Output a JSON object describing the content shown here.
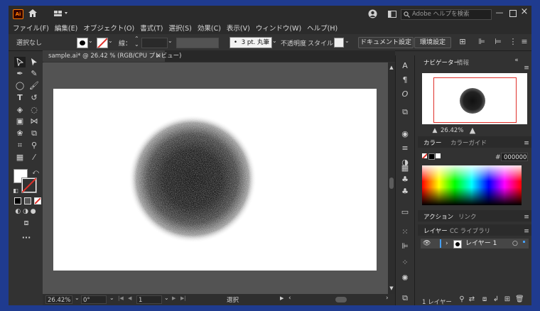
{
  "titlebar": {
    "app_badge": "Ai",
    "search_placeholder": "Adobe ヘルプを検索"
  },
  "menu": [
    "ファイル(F)",
    "編集(E)",
    "オブジェクト(O)",
    "書式(T)",
    "選択(S)",
    "効果(C)",
    "表示(V)",
    "ウィンドウ(W)",
    "ヘルプ(H)"
  ],
  "control": {
    "selection": "選択なし",
    "stroke_label": "線：",
    "brush_value": "3 pt. 丸筆",
    "opacity_label": "不透明度",
    "style_label": "スタイル：",
    "doc_settings": "ドキュメント設定",
    "prefs": "環境設定"
  },
  "document": {
    "tab_title": "sample.ai* @ 26.42 % (RGB/CPU プレビュー)",
    "close": "×"
  },
  "status": {
    "zoom": "26.42%",
    "rotation": "0°",
    "artboard": "1",
    "tool": "選択"
  },
  "navigator": {
    "tab": "ナビゲーター",
    "tab2": "情報",
    "zoom": "26.42%"
  },
  "color": {
    "tab": "カラー",
    "tab2": "カラーガイド",
    "hash": "#",
    "hex": "000000"
  },
  "actions": {
    "tab": "アクション",
    "tab2": "リンク"
  },
  "layers": {
    "tab": "レイヤー",
    "tab2": "CC ライブラリ",
    "layer_name": "レイヤー 1",
    "count": "1 レイヤー"
  },
  "colors": {
    "panel": "#323232",
    "dark": "#2b2b2b",
    "canvas": "#535353",
    "selection_blue": "#46a0f5",
    "none_red": "#e0302a"
  }
}
